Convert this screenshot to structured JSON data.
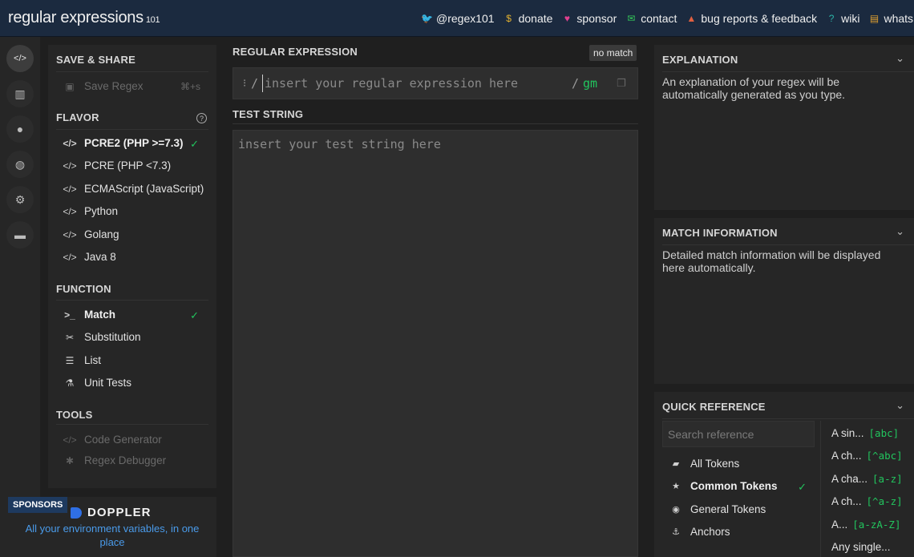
{
  "header": {
    "logo_main": "regular expressions",
    "logo_sub": "101",
    "links": [
      {
        "label": "@regex101",
        "icon": "twitter-icon",
        "glyph": "🐦",
        "color": "#4aa3ec"
      },
      {
        "label": "donate",
        "icon": "dollar-icon",
        "glyph": "$",
        "color": "#e0b030"
      },
      {
        "label": "sponsor",
        "icon": "heart-icon",
        "glyph": "♥",
        "color": "#e0408f"
      },
      {
        "label": "contact",
        "icon": "mail-icon",
        "glyph": "✉",
        "color": "#34c759"
      },
      {
        "label": "bug reports & feedback",
        "icon": "warning-icon",
        "glyph": "▲",
        "color": "#e06040"
      },
      {
        "label": "wiki",
        "icon": "wiki-icon",
        "glyph": "?",
        "color": "#2bb3a6"
      },
      {
        "label": "whats new",
        "icon": "news-icon",
        "glyph": "▤",
        "color": "#e0a030"
      }
    ]
  },
  "iconbar": [
    {
      "name": "regex-editor-icon",
      "glyph": "</>",
      "active": true
    },
    {
      "name": "library-icon",
      "glyph": "▥",
      "active": false
    },
    {
      "name": "account-icon",
      "glyph": "●",
      "active": false
    },
    {
      "name": "quiz-icon",
      "glyph": "◍",
      "active": false
    },
    {
      "name": "settings-icon",
      "glyph": "⚙",
      "active": false
    },
    {
      "name": "chat-icon",
      "glyph": "▬",
      "active": false
    }
  ],
  "left": {
    "save_share": {
      "title": "SAVE & SHARE",
      "save_label": "Save Regex",
      "save_shortcut": "⌘+s"
    },
    "flavor": {
      "title": "FLAVOR",
      "items": [
        {
          "label": "PCRE2 (PHP >=7.3)",
          "selected": true
        },
        {
          "label": "PCRE (PHP <7.3)",
          "selected": false
        },
        {
          "label": "ECMAScript (JavaScript)",
          "selected": false
        },
        {
          "label": "Python",
          "selected": false
        },
        {
          "label": "Golang",
          "selected": false
        },
        {
          "label": "Java 8",
          "selected": false
        }
      ]
    },
    "function": {
      "title": "FUNCTION",
      "items": [
        {
          "label": "Match",
          "icon": "terminal-icon",
          "glyph": ">_",
          "selected": true
        },
        {
          "label": "Substitution",
          "icon": "scissors-icon",
          "glyph": "✂",
          "selected": false
        },
        {
          "label": "List",
          "icon": "list-icon",
          "glyph": "☰",
          "selected": false
        },
        {
          "label": "Unit Tests",
          "icon": "flask-icon",
          "glyph": "⚗",
          "selected": false
        }
      ]
    },
    "tools": {
      "title": "TOOLS",
      "items": [
        {
          "label": "Code Generator",
          "icon": "code-icon",
          "glyph": "</>"
        },
        {
          "label": "Regex Debugger",
          "icon": "bug-icon",
          "glyph": "✱"
        }
      ]
    }
  },
  "sponsor": {
    "badge": "SPONSORS",
    "brand": "DOPPLER",
    "text": "All your environment variables, in one place"
  },
  "regex": {
    "title": "REGULAR EXPRESSION",
    "status": "no match",
    "open_delim": "/",
    "close_delim": "/",
    "flags": "gm",
    "placeholder": "insert your regular expression here",
    "value": ""
  },
  "test": {
    "title": "TEST STRING",
    "placeholder": "insert your test string here",
    "value": ""
  },
  "explanation": {
    "title": "EXPLANATION",
    "body": "An explanation of your regex will be automatically generated as you type."
  },
  "match_info": {
    "title": "MATCH INFORMATION",
    "body": "Detailed match information will be displayed here automatically."
  },
  "quick_ref": {
    "title": "QUICK REFERENCE",
    "search_placeholder": "Search reference",
    "categories": [
      {
        "label": "All Tokens",
        "icon": "stack-icon",
        "glyph": "▰",
        "selected": false
      },
      {
        "label": "Common Tokens",
        "icon": "star-icon",
        "glyph": "★",
        "selected": true
      },
      {
        "label": "General Tokens",
        "icon": "target-icon",
        "glyph": "◉",
        "selected": false
      },
      {
        "label": "Anchors",
        "icon": "anchor-icon",
        "glyph": "⚓",
        "selected": false
      }
    ],
    "tokens": [
      {
        "label": "A sin...",
        "code": "[abc]"
      },
      {
        "label": "A ch...",
        "code": "[^abc]"
      },
      {
        "label": "A cha...",
        "code": "[a-z]"
      },
      {
        "label": "A ch...",
        "code": "[^a-z]"
      },
      {
        "label": "A...",
        "code": "[a-zA-Z]"
      },
      {
        "label": "Any single...",
        "code": ""
      }
    ]
  }
}
